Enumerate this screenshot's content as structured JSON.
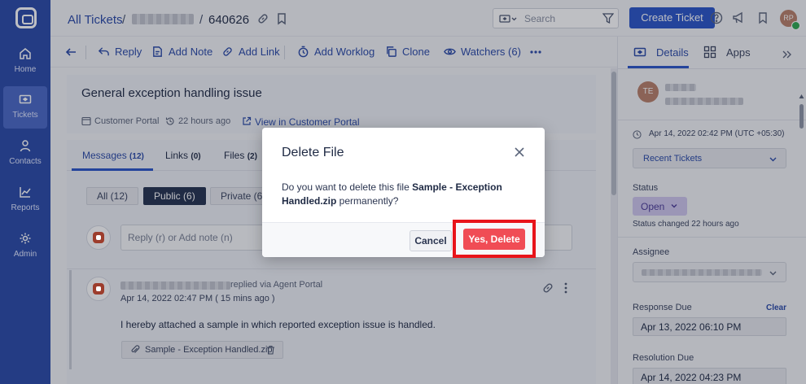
{
  "nav": {
    "items": [
      {
        "label": "Home",
        "icon": "home-icon"
      },
      {
        "label": "Tickets",
        "icon": "ticket-icon"
      },
      {
        "label": "Contacts",
        "icon": "person-icon"
      },
      {
        "label": "Reports",
        "icon": "chart-icon"
      },
      {
        "label": "Admin",
        "icon": "gear-icon"
      }
    ],
    "active": "Tickets"
  },
  "header": {
    "breadcrumb_root": "All Tickets",
    "separator": "/",
    "ticket_id": "640626",
    "search_placeholder": "Search",
    "create_button": "Create Ticket",
    "user_initials": "RP"
  },
  "toolbar": {
    "actions": [
      {
        "label": "Reply",
        "icon": "reply-icon"
      },
      {
        "label": "Add Note",
        "icon": "note-icon"
      },
      {
        "label": "Add Link",
        "icon": "link-icon"
      },
      {
        "label": "Add Worklog",
        "icon": "worklog-icon"
      },
      {
        "label": "Clone",
        "icon": "clone-icon"
      },
      {
        "label": "Watchers (6)",
        "icon": "eye-icon"
      }
    ]
  },
  "ticket": {
    "title": "General exception handling issue",
    "source": "Customer Portal",
    "age": "22 hours ago",
    "portal_link": "View in Customer Portal"
  },
  "tabs": [
    {
      "label": "Messages",
      "count": "(12)"
    },
    {
      "label": "Links",
      "count": "(0)"
    },
    {
      "label": "Files",
      "count": "(2)"
    }
  ],
  "filters": [
    "All (12)",
    "Public (6)",
    "Private (6)"
  ],
  "reply_placeholder": "Reply (r) or Add note (n)",
  "message": {
    "via": "replied via Agent Portal",
    "timestamp": "Apr 14, 2022 02:47 PM ( 15 mins ago )",
    "body": "I hereby attached a sample in which reported exception issue is handled.",
    "attachment": "Sample - Exception Handled.zip"
  },
  "details": {
    "tab_details": "Details",
    "tab_apps": "Apps",
    "contact_initials": "TE",
    "created": "Apr 14, 2022 02:42 PM (UTC +05:30)",
    "recent_tickets": "Recent Tickets",
    "status_label": "Status",
    "status_value": "Open",
    "status_changed": "Status changed 22 hours ago",
    "assignee_label": "Assignee",
    "response_due_label": "Response Due",
    "clear": "Clear",
    "response_due_value": "Apr 13, 2022 06:10 PM",
    "resolution_due_label": "Resolution Due",
    "resolution_due_value": "Apr 14, 2022 04:23 PM"
  },
  "modal": {
    "title": "Delete File",
    "body_prefix": "Do you want to delete this file ",
    "filename": "Sample - Exception Handled.zip",
    "body_suffix": " permanently?",
    "cancel": "Cancel",
    "confirm": "Yes, Delete"
  },
  "colors": {
    "nav_bg": "#2a4aa8",
    "primary": "#2a55c8",
    "danger": "#f04c55",
    "highlight": "#e8141a",
    "status_pill": "#cfc6ee"
  }
}
